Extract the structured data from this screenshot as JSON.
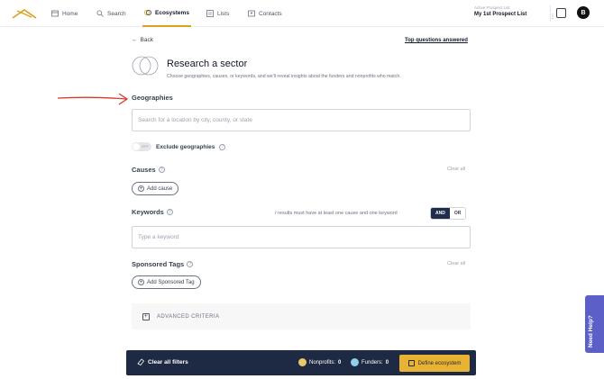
{
  "nav": {
    "items": [
      {
        "label": "Home",
        "icon": "home-icon"
      },
      {
        "label": "Search",
        "icon": "search-icon"
      },
      {
        "label": "Ecosystems",
        "icon": "ecosystem-icon",
        "active": true
      },
      {
        "label": "Lists",
        "icon": "list-icon"
      },
      {
        "label": "Contacts",
        "icon": "contacts-icon"
      }
    ],
    "prospect_label": "Active Prospect List",
    "prospect_value": "My 1st Prospect List",
    "avatar": "B"
  },
  "header": {
    "back": "Back",
    "top_questions": "Top questions answered",
    "title": "Research a sector",
    "subtitle": "Choose geographies, causes, or keywords, and we'll reveal insights about the funders and nonprofits who match."
  },
  "geographies": {
    "label": "Geographies",
    "placeholder": "Search for a location by city, county, or state",
    "toggle_state": "OFF",
    "exclude_label": "Exclude geographies"
  },
  "causes": {
    "label": "Causes",
    "clear": "Clear all",
    "add": "Add cause"
  },
  "keywords": {
    "label": "Keywords",
    "note": "/ results must have at least one cause and one keyword",
    "and": "AND",
    "or": "OR",
    "placeholder": "Type a keyword"
  },
  "tags": {
    "label": "Sponsored Tags",
    "clear": "Clear all",
    "add": "Add Sponsored Tag"
  },
  "advanced": {
    "label": "ADVANCED CRITERIA"
  },
  "footer": {
    "clear_filters": "Clear all filters",
    "nonprofits_label": "Nonprofits:",
    "nonprofits_count": "0",
    "funders_label": "Funders:",
    "funders_count": "0",
    "define": "Define ecosystem"
  },
  "help_tab": "Need Help?",
  "colors": {
    "accent": "#e8b233",
    "navy": "#1e2a44",
    "help": "#5b5fc7",
    "annotation_arrow": "#d9382b"
  }
}
